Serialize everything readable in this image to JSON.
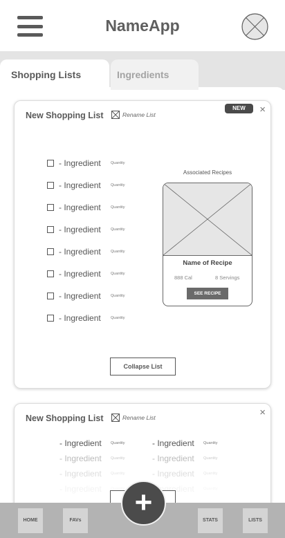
{
  "header": {
    "title": "NameApp",
    "menu_icon": "hamburger-menu-icon",
    "avatar_icon": "avatar-placeholder-icon"
  },
  "tabs": [
    {
      "label": "Shopping Lists",
      "active": true
    },
    {
      "label": "Ingredients",
      "active": false
    }
  ],
  "list1": {
    "title": "New Shopping List",
    "rename_label": "Rename List",
    "badge": "NEW",
    "close_label": "×",
    "ingredients": [
      {
        "label": "- Ingredient",
        "qty": "Quantity"
      },
      {
        "label": "- Ingredient",
        "qty": "Quantity"
      },
      {
        "label": "- Ingredient",
        "qty": "Quantity"
      },
      {
        "label": "- Ingredient",
        "qty": "Quantity"
      },
      {
        "label": "- Ingredient",
        "qty": "Quantity"
      },
      {
        "label": "- Ingredient",
        "qty": "Quantity"
      },
      {
        "label": "- Ingredient",
        "qty": "Quantity"
      },
      {
        "label": "- Ingredient",
        "qty": "Quantity"
      }
    ],
    "associated_title": "Associated Recipes",
    "recipe": {
      "name": "Name of Recipe",
      "calories": "888 Cal",
      "servings": "8 Servings",
      "button": "SEE RECIPE"
    },
    "collapse_label": "Collapse List"
  },
  "list2": {
    "title": "New Shopping List",
    "rename_label": "Rename List",
    "close_label": "×",
    "ingredients_left": [
      {
        "label": "- Ingredient",
        "qty": "Quantity"
      },
      {
        "label": "- Ingredient",
        "qty": "Quantity"
      },
      {
        "label": "- Ingredient",
        "qty": "Quantity"
      },
      {
        "label": "- Ingredient",
        "qty": "Quantity"
      }
    ],
    "ingredients_right": [
      {
        "label": "- Ingredient",
        "qty": "Quantity"
      },
      {
        "label": "- Ingredient",
        "qty": "Quantity"
      },
      {
        "label": "- Ingredient",
        "qty": "Quantity"
      },
      {
        "label": "- Ingredient",
        "qty": "Quantity"
      }
    ]
  },
  "bottom_nav": {
    "home": "HOME",
    "favs": "FAVs",
    "stats": "STATS",
    "lists": "LISTS",
    "fab": "+"
  },
  "colors": {
    "tab_bar": "#e4e4e4",
    "nav_bar": "#b3b3b3",
    "fab": "#4b4b4b",
    "badge": "#4a4a4a"
  }
}
